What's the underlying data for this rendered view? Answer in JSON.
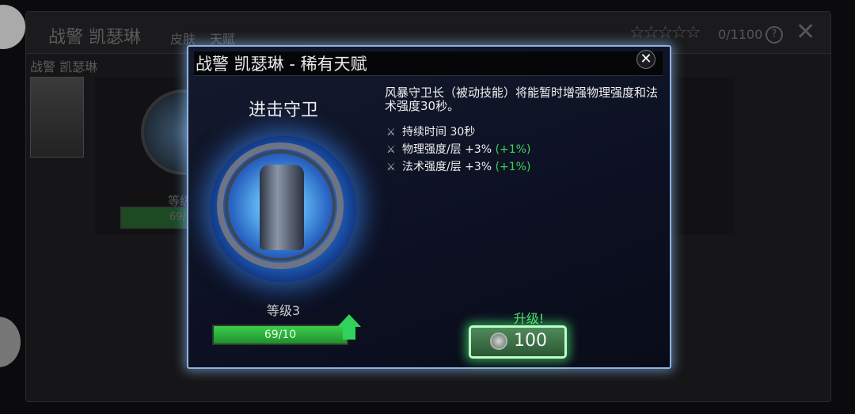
{
  "background": {
    "title": "战警 凯瑟琳",
    "tabs": [
      "皮肤",
      "天赋"
    ],
    "stars": "☆☆☆☆☆",
    "star_count": "0/1100",
    "help": "?",
    "close": "✕",
    "subtitle": "战警 凯瑟琳",
    "level_text": "等级",
    "bar_text": "69/"
  },
  "dialog": {
    "title": "战警 凯瑟琳 - 稀有天赋",
    "close": "✕",
    "talent_name": "进击守卫",
    "description": "风暴守卫长（被动技能）将能暂时增强物理强度和法术强度30秒。",
    "stats": [
      {
        "label": "持续时间 30秒",
        "bonus": ""
      },
      {
        "label": "物理强度/层 +3%",
        "bonus": "(+1%)"
      },
      {
        "label": "法术强度/层 +3%",
        "bonus": "(+1%)"
      }
    ],
    "level_label": "等级3",
    "progress_text": "69/10",
    "progress_fraction": 1.0,
    "upgrade_label": "升级!",
    "upgrade_cost": "100"
  },
  "colors": {
    "dialog_border": "#8fb2e0",
    "progress_green": "#3ccd4c",
    "bonus_green": "#3fd35a",
    "upgrade_glow": "#b8ffc8"
  },
  "icons": {
    "stat_icon": "sword-icon",
    "coin_icon": "talent-coin-icon"
  }
}
